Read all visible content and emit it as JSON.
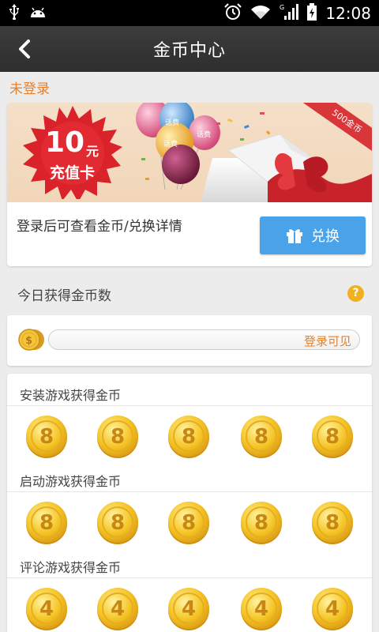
{
  "status_bar": {
    "time": "12:08"
  },
  "header": {
    "title": "金币中心"
  },
  "login_hint": "未登录",
  "banner": {
    "amount": "10",
    "unit": "元",
    "card_text": "充值卡",
    "ribbon": "500金币"
  },
  "card": {
    "description": "登录后可查看金币/兑换详情",
    "exchange_label": "兑换"
  },
  "today": {
    "label": "今日获得金币数",
    "progress_text": "登录可见"
  },
  "sections": [
    {
      "title": "安装游戏获得金币",
      "coins": [
        "8",
        "8",
        "8",
        "8",
        "8"
      ]
    },
    {
      "title": "启动游戏获得金币",
      "coins": [
        "8",
        "8",
        "8",
        "8",
        "8"
      ]
    },
    {
      "title": "评论游戏获得金币",
      "coins": [
        "4",
        "4",
        "4",
        "4",
        "4"
      ]
    }
  ],
  "colors": {
    "accent_orange": "#e7802a",
    "button_blue": "#4aa3e8",
    "coin_gold": "#f5c425"
  }
}
